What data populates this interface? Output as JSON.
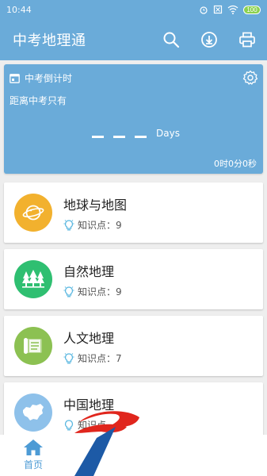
{
  "status_bar": {
    "time": "10:44",
    "battery": "100"
  },
  "app_bar": {
    "title": "中考地理通",
    "actions": [
      "search-icon",
      "download-icon",
      "print-icon"
    ]
  },
  "countdown": {
    "title": "中考倒计时",
    "subtitle": "距离中考只有",
    "days_label": "Days",
    "clock": "0时0分0秒"
  },
  "topics": [
    {
      "title": "地球与地图",
      "meta": "知识点：9",
      "icon": "planet-icon",
      "color": "#f2b12e"
    },
    {
      "title": "自然地理",
      "meta": "知识点：9",
      "icon": "forest-icon",
      "color": "#2fbf71"
    },
    {
      "title": "人文地理",
      "meta": "知识点：7",
      "icon": "map-scroll-icon",
      "color": "#8cc152"
    },
    {
      "title": "中国地理",
      "meta": "知识点",
      "icon": "china-map-icon",
      "color": "#8ec1ea"
    }
  ],
  "bottom_nav": {
    "home_label": "首页"
  },
  "colors": {
    "primary": "#6aabd9",
    "nav_active": "#4d9bd5"
  }
}
